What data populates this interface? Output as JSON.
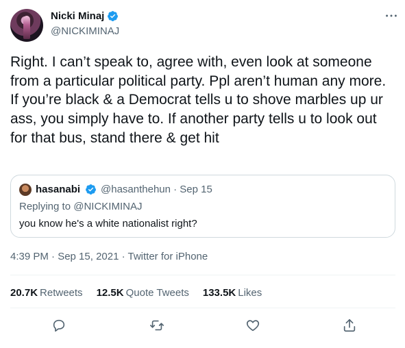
{
  "author": {
    "display_name": "Nicki Minaj",
    "handle": "@NICKIMINAJ",
    "verified": true
  },
  "menu_icon": "more-horizontal-icon",
  "tweet_text": "Right. I can’t speak to, agree with, even look at someone from a particular political party. Ppl aren’t human any more. If you’re black & a Democrat tells u to shove marbles up ur ass, you simply have to. If another party tells u to look out for that bus, stand there & get hit",
  "quoted_tweet": {
    "display_name": "hasanabi",
    "verified": true,
    "handle_date": "@hasanthehun · Sep 15",
    "replying_prefix": "Replying to ",
    "replying_to": "@NICKIMINAJ",
    "text": "you know he's a white nationalist right?"
  },
  "timestamp": "4:39 PM · Sep 15, 2021 · Twitter for iPhone",
  "stats": {
    "retweets_count": "20.7K",
    "retweets_label": "Retweets",
    "quotes_count": "12.5K",
    "quotes_label": "Quote Tweets",
    "likes_count": "133.5K",
    "likes_label": "Likes"
  },
  "actions": [
    "reply-icon",
    "retweet-icon",
    "like-icon",
    "share-icon"
  ],
  "colors": {
    "text": "#0f1419",
    "secondary": "#536471",
    "verified_blue": "#1d9bf0",
    "border": "#cfd9de",
    "divider": "#eff3f4"
  }
}
